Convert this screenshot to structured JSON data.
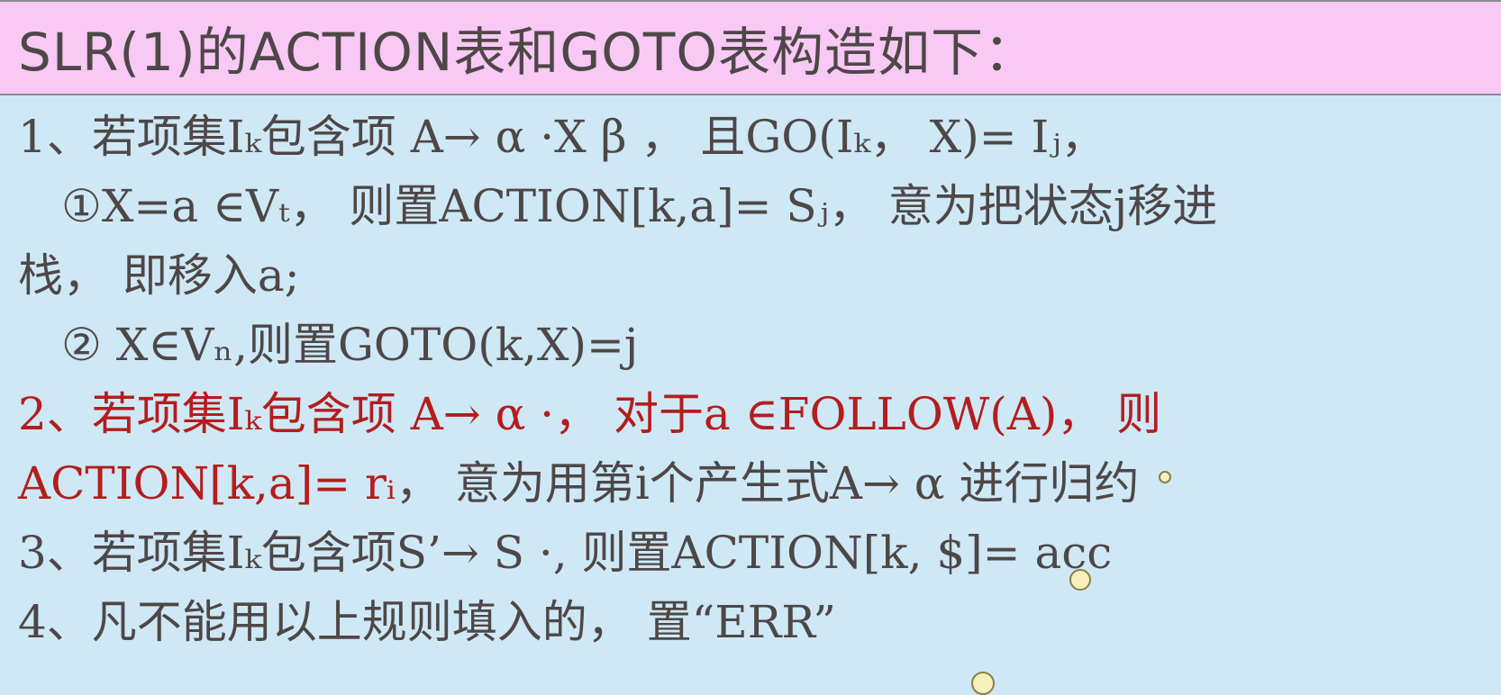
{
  "title": "SLR(1)的ACTION表和GOTO表构造如下：",
  "rules": [
    {
      "text": "1、若项集Iₖ包含项 A→ α ·X β ， 且GO(Iₖ， X)= Iⱼ，",
      "style": "normal"
    },
    {
      "text": "①X=a ∈Vₜ， 则置ACTION[k,a]= Sⱼ， 意为把状态j移进",
      "style": "normal"
    },
    {
      "text": "栈， 即移入a;",
      "style": "normal"
    },
    {
      "text": "② X∈Vₙ,则置GOTO(k,X)=j",
      "style": "normal"
    },
    {
      "text": "2、若项集Iₖ包含项 A→ α ·， 对于a ∈FOLLOW(A)， 则",
      "style": "red"
    },
    {
      "text_red": "ACTION[k,a]= rᵢ",
      "text_rest": "， 意为用第i个产生式A→ α 进行归约",
      "style": "mixed"
    },
    {
      "text": "3、若项集Iₖ包含项S’→ S ·, 则置ACTION[k, $]= acc",
      "style": "normal"
    },
    {
      "text": "4、凡不能用以上规则填入的， 置“ERR”",
      "style": "normal"
    }
  ],
  "colors": {
    "title_bg": "#f8c9f4",
    "content_bg": "#cfe8f5",
    "text": "#4e4747",
    "accent_red": "#b41d1d"
  }
}
